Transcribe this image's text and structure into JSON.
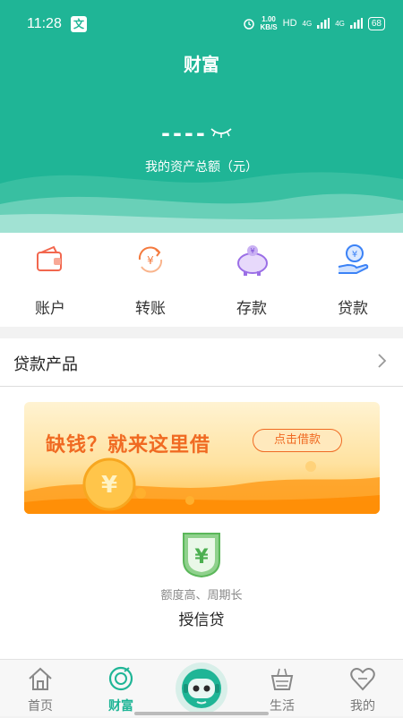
{
  "status_bar": {
    "time": "11:28",
    "app_badge": "文",
    "speed_value": "1.00",
    "speed_unit": "KB/S",
    "network": "HD",
    "signal_1": "4G",
    "signal_2": "4G",
    "battery": "68"
  },
  "header": {
    "title": "财富",
    "balance_masked": "----",
    "asset_label": "我的资产总额（元）",
    "accent_color": "#1fb596"
  },
  "quick_actions": [
    {
      "label": "账户",
      "icon": "wallet-icon"
    },
    {
      "label": "转账",
      "icon": "transfer-icon"
    },
    {
      "label": "存款",
      "icon": "piggy-bank-icon"
    },
    {
      "label": "贷款",
      "icon": "loan-icon"
    }
  ],
  "loan_section": {
    "title": "贷款产品",
    "banner_text": "缺钱？就来这里借",
    "banner_button": "点击借款",
    "product_subtitle": "额度高、周期长",
    "product_name": "授信贷"
  },
  "tab_bar": {
    "items": [
      {
        "label": "首页",
        "icon": "home-icon",
        "active": false
      },
      {
        "label": "财富",
        "icon": "wealth-icon",
        "active": true
      },
      {
        "label": "生活",
        "icon": "shopping-basket-icon",
        "active": false
      },
      {
        "label": "我的",
        "icon": "heart-icon",
        "active": false
      }
    ],
    "center_icon": "robot-assistant-icon"
  }
}
